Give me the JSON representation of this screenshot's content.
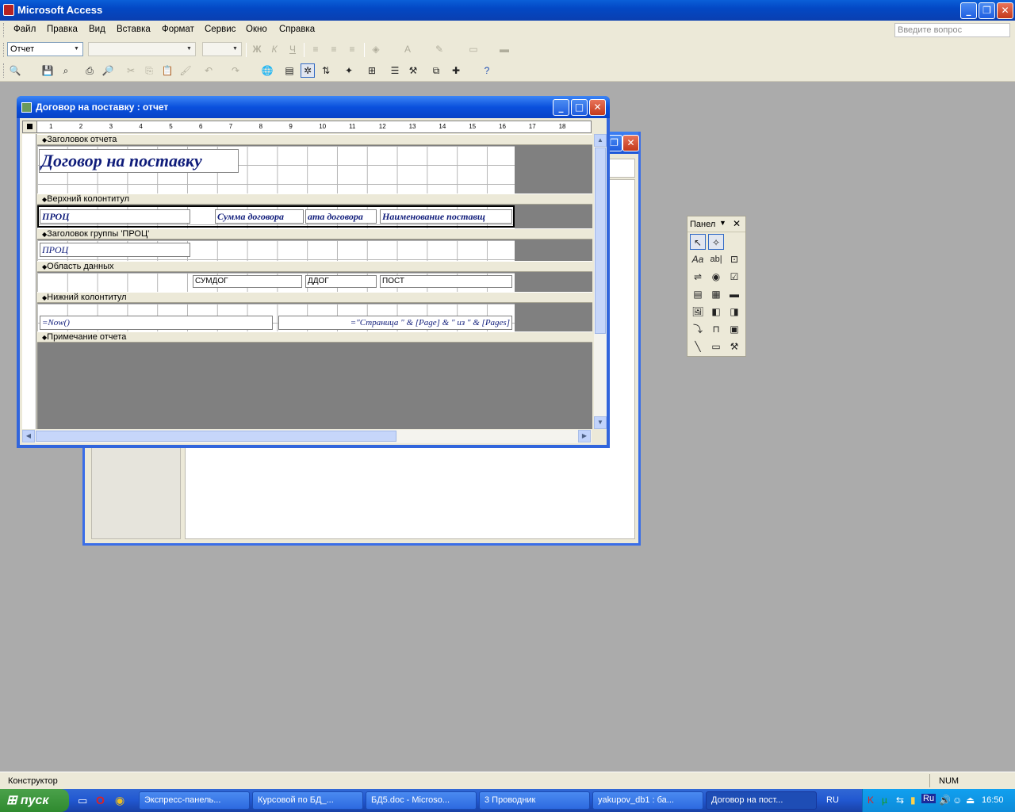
{
  "app": {
    "title": "Microsoft Access"
  },
  "menu": {
    "items": [
      "Файл",
      "Правка",
      "Вид",
      "Вставка",
      "Формат",
      "Сервис",
      "Окно",
      "Справка"
    ],
    "ask_placeholder": "Введите вопрос"
  },
  "format_toolbar": {
    "object_combo": "Отчет",
    "font_combo": "",
    "size_combo": ""
  },
  "report_window": {
    "title": "Договор на поставку : отчет",
    "ruler_ticks": [
      "1",
      "2",
      "3",
      "4",
      "5",
      "6",
      "7",
      "8",
      "9",
      "10",
      "11",
      "12",
      "13",
      "14",
      "15",
      "16",
      "17",
      "18"
    ],
    "bands": {
      "report_header": "Заголовок отчета",
      "page_header": "Верхний колонтитул",
      "group_header": "Заголовок группы 'ПРОЦ'",
      "detail": "Область данных",
      "page_footer": "Нижний колонтитул",
      "report_footer": "Примечание отчета"
    },
    "controls": {
      "report_title": "Договор на поставку",
      "ph_proc": "ПРОЦ",
      "ph_sum": "Сумма договора",
      "ph_date": "ата договора",
      "ph_supplier": "Наименование поставщ",
      "gh_proc": "ПРОЦ",
      "d_sumdog": "СУМДОГ",
      "d_ddog": "ДДОГ",
      "d_post": "ПОСТ",
      "pf_now": "=Now()",
      "pf_pages": "=\"Страница \" & [Page] & \" из \" & [Pages]"
    }
  },
  "toolbox": {
    "title": "Панел"
  },
  "statusbar": {
    "mode": "Конструктор",
    "num": "NUM"
  },
  "taskbar": {
    "start": "пуск",
    "tasks": [
      "Экспресс-панель...",
      "Курсовой по БД_...",
      "БД5.doc - Microso...",
      "3 Проводник",
      "yakupov_db1 : ба...",
      "Договор на пост..."
    ],
    "lang": "RU",
    "clock": "16:50"
  }
}
